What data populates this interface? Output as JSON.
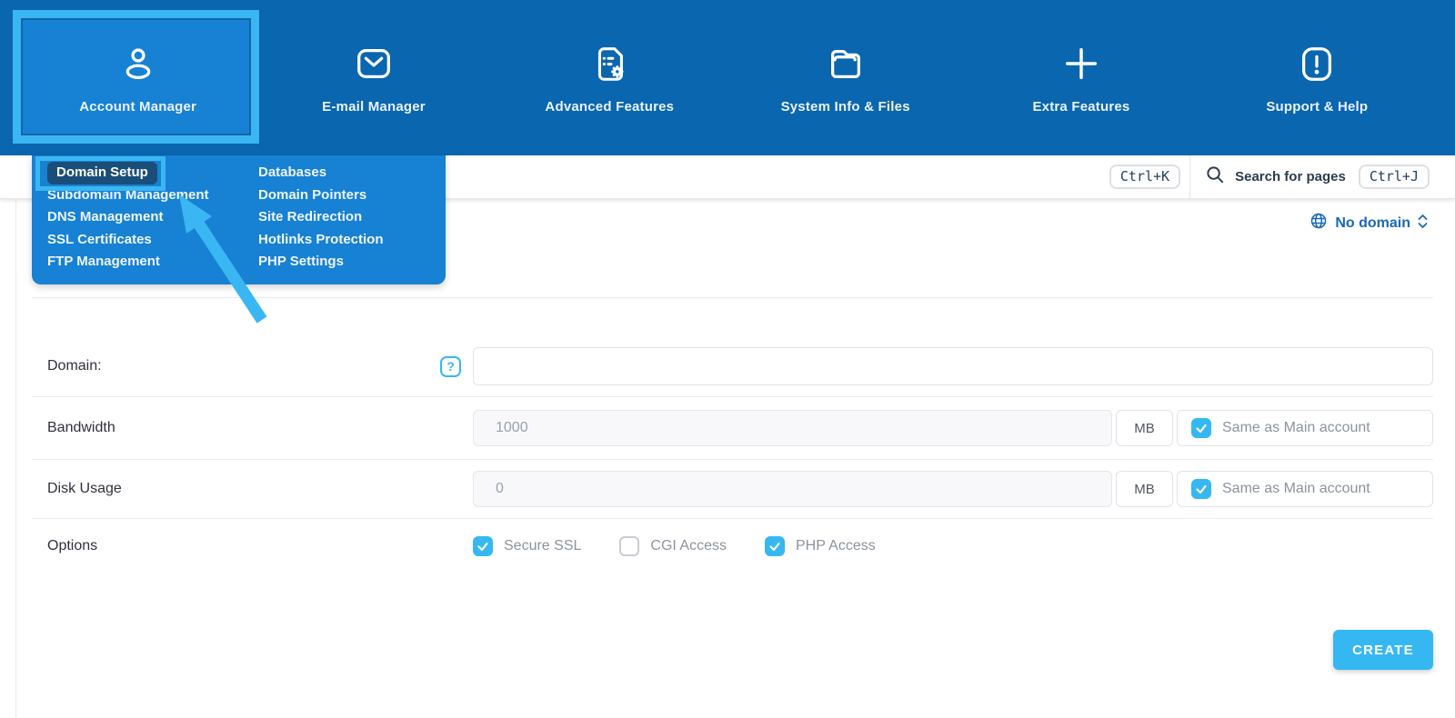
{
  "nav": {
    "items": [
      {
        "label": "Account Manager",
        "icon": "person-icon",
        "active": true
      },
      {
        "label": "E-mail Manager",
        "icon": "envelope-icon",
        "active": false
      },
      {
        "label": "Advanced Features",
        "icon": "document-gear-icon",
        "active": false
      },
      {
        "label": "System Info & Files",
        "icon": "folder-icon",
        "active": false
      },
      {
        "label": "Extra Features",
        "icon": "plus-icon",
        "active": false
      },
      {
        "label": "Support & Help",
        "icon": "alert-icon",
        "active": false
      }
    ]
  },
  "dropdown": {
    "left": [
      "Domain Setup",
      "Subdomain Management",
      "DNS Management",
      "SSL Certificates",
      "FTP Management"
    ],
    "right": [
      "Databases",
      "Domain Pointers",
      "Site Redirection",
      "Hotlinks Protection",
      "PHP Settings"
    ],
    "highlighted": "Domain Setup"
  },
  "header": {
    "shortcut_command": "Ctrl+K",
    "search_label": "Search for pages",
    "shortcut_pages": "Ctrl+J"
  },
  "domain_selector": {
    "label": "No domain"
  },
  "form": {
    "domain": {
      "label": "Domain:",
      "value": "",
      "help": "?"
    },
    "bandwidth": {
      "label": "Bandwidth",
      "value": "1000",
      "unit": "MB",
      "same_label": "Same as Main account",
      "same_checked": true
    },
    "disk_usage": {
      "label": "Disk Usage",
      "value": "0",
      "unit": "MB",
      "same_label": "Same as Main account",
      "same_checked": true
    },
    "options": {
      "label": "Options",
      "items": [
        {
          "label": "Secure SSL",
          "checked": true
        },
        {
          "label": "CGI Access",
          "checked": false
        },
        {
          "label": "PHP Access",
          "checked": true
        }
      ]
    }
  },
  "actions": {
    "create_label": "CREATE"
  },
  "colors": {
    "navy": "#0a66ae",
    "panel_blue": "#1781d3",
    "annotation_cyan": "#3ab6f2",
    "pill_navy": "#1a4e78",
    "accent_cyan": "#35b8f2",
    "link_blue": "#1769b8",
    "text_dark": "#30303c",
    "muted": "#8d939d"
  }
}
